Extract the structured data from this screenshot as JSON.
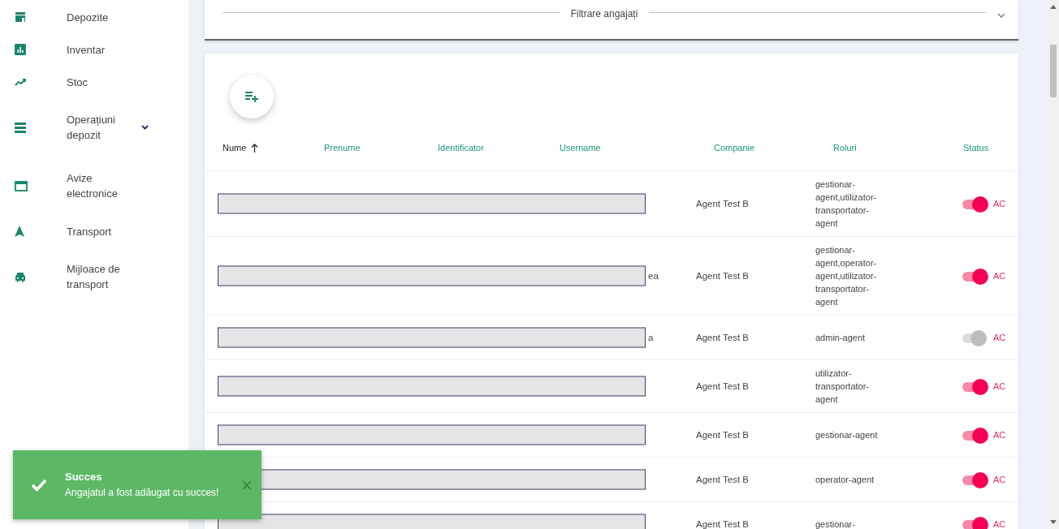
{
  "sidebar": {
    "items": [
      {
        "label": "Depozite"
      },
      {
        "label": "Inventar"
      },
      {
        "label": "Stoc"
      },
      {
        "label": "Operațiuni depozit",
        "expanded": false
      },
      {
        "label": "Avize electronice"
      },
      {
        "label": "Transport"
      },
      {
        "label": "Mijloace de transport"
      }
    ]
  },
  "filter_panel": {
    "title": "Filtrare angajați",
    "expanded": false
  },
  "table": {
    "columns": [
      {
        "label": "Nume",
        "sorted": true
      },
      {
        "label": "Prenume",
        "sorted": false
      },
      {
        "label": "Identificator",
        "sorted": false
      },
      {
        "label": "Username",
        "sorted": false
      },
      {
        "label": "Companie",
        "sorted": false
      },
      {
        "label": "Roluri",
        "sorted": false
      },
      {
        "label": "Status",
        "sorted": false
      }
    ],
    "rows": [
      {
        "company": "Agent Test B",
        "roles": "gestionar-agent,utilizator-transportator-agent",
        "active": true,
        "status": "AC"
      },
      {
        "username_tail": "ea",
        "company": "Agent Test B",
        "roles": "gestionar-agent,operator-agent,utilizator-transportator-agent",
        "active": true,
        "status": "AC"
      },
      {
        "username_tail": "a",
        "company": "Agent Test B",
        "roles": "admin-agent",
        "active": false,
        "status": "AC"
      },
      {
        "company": "Agent Test B",
        "roles": "utilizator-transportator-agent",
        "active": true,
        "status": "AC"
      },
      {
        "company": "Agent Test B",
        "roles": "gestionar-agent",
        "active": true,
        "status": "AC"
      },
      {
        "company": "Agent Test B",
        "roles": "operator-agent",
        "active": true,
        "status": "AC"
      },
      {
        "company": "Agent Test B",
        "roles": "gestionar-",
        "active": true,
        "status": "AC"
      }
    ]
  },
  "toast": {
    "title": "Succes",
    "message": "Angajatul a fost adăugat cu succes!"
  }
}
